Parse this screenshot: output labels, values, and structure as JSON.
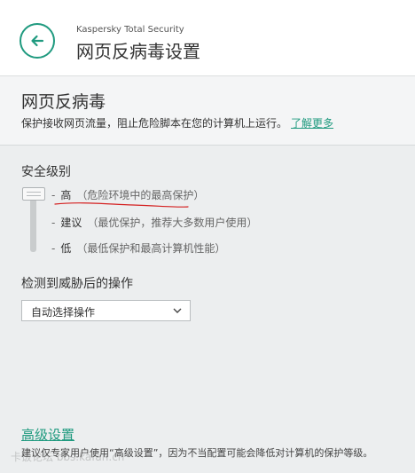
{
  "header": {
    "app_name": "Kaspersky Total Security",
    "title": "网页反病毒设置"
  },
  "intro": {
    "title": "网页反病毒",
    "description": "保护接收网页流量，阻止危险脚本在您的计算机上运行。",
    "learn_more": "了解更多"
  },
  "security_level": {
    "label": "安全级别",
    "selected_index": 0,
    "levels": [
      {
        "name": "高",
        "desc": "（危险环境中的最高保护）"
      },
      {
        "name": "建议",
        "desc": "（最优保护，推荐大多数用户使用）"
      },
      {
        "name": "低",
        "desc": "（最低保护和最高计算机性能）"
      }
    ]
  },
  "threat_action": {
    "label": "检测到威胁后的操作",
    "selected": "自动选择操作"
  },
  "advanced": {
    "link": "高级设置",
    "note": "建议仅专家用户使用“高级设置”，因为不当配置可能会降低对计算机的保护等级。"
  },
  "watermark": "卡饭论坛 bbs.kafan.cn",
  "colors": {
    "accent": "#1f9a7f",
    "annotation": "#d42020"
  }
}
